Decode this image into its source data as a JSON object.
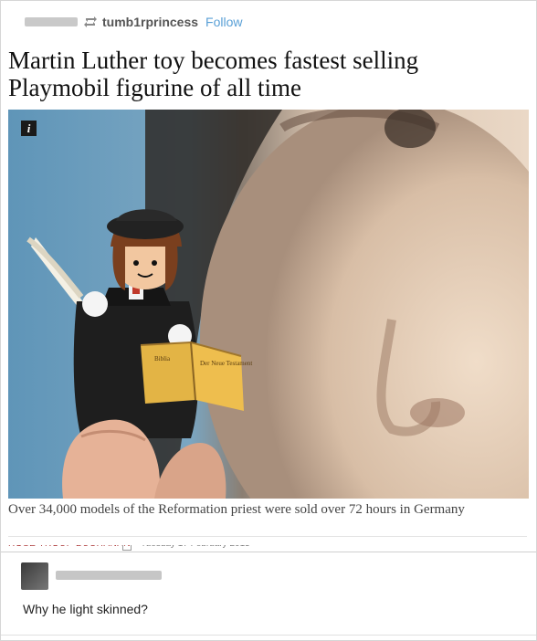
{
  "post": {
    "reblogged_from": "tumb1rprincess",
    "follow_label": "Follow",
    "headline": "Martin Luther toy becomes fastest selling Playmobil figurine of all time",
    "info_badge": "i",
    "caption": "Over 34,000 models of the Reformation priest were sold over 72 hours in Germany",
    "figure_book_text": [
      "Biblia",
      "Der Neue Testament"
    ]
  },
  "comment": {
    "text": "Why he light skinned?"
  }
}
